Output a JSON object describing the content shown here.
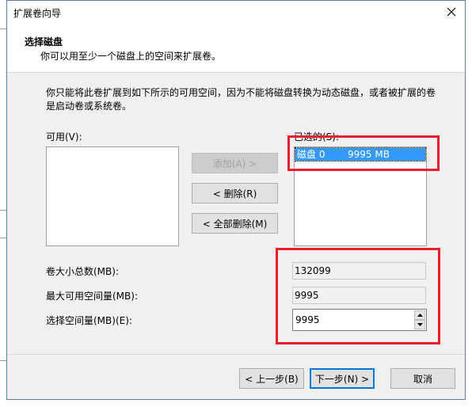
{
  "window": {
    "title": "扩展卷向导"
  },
  "header": {
    "title": "选择磁盘",
    "subtitle": "你可以用至少一个磁盘上的空间来扩展卷。"
  },
  "description": "你只能将此卷扩展到如下所示的可用空间，因为不能将磁盘转换为动态磁盘，或者被扩展的卷是启动卷或系统卷。",
  "available": {
    "label": "可用(V):",
    "items": []
  },
  "selected": {
    "label": "已选的(S):",
    "items": [
      {
        "disk": "磁盘 0",
        "size": "9995 MB"
      }
    ]
  },
  "buttons": {
    "add": "添加(A) >",
    "remove": "< 删除(R)",
    "remove_all": "< 全部删除(M)",
    "back": "< 上一步(B)",
    "next": "下一步(N) >",
    "cancel": "取消"
  },
  "fields": {
    "total_size_label": "卷大小总数(MB):",
    "total_size_value": "132099",
    "max_available_label": "最大可用空间量(MB):",
    "max_available_value": "9995",
    "select_amount_label": "选择空间量(MB)(E):",
    "select_amount_value": "9995"
  },
  "colors": {
    "selection": "#3399ff",
    "highlight": "#e8202a",
    "accent": "#0078d7"
  }
}
